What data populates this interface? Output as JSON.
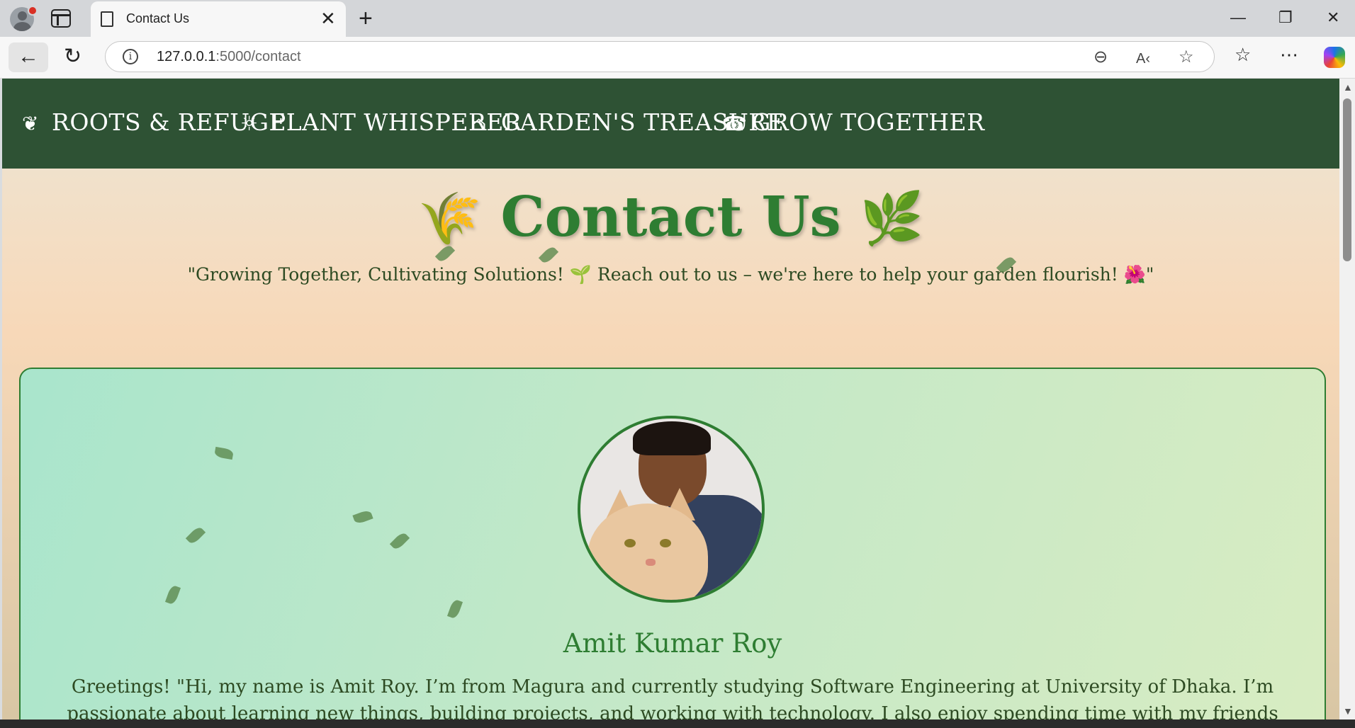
{
  "browser": {
    "tab_title": "Contact Us",
    "url_host": "127.0.0.1",
    "url_path": ":5000/contact"
  },
  "nav": {
    "items": [
      {
        "label": "ROOTS & REFUGE",
        "icon": "leaf-icon"
      },
      {
        "label": "PLANT WHISPERER",
        "icon": "lightbulb-icon"
      },
      {
        "label": "GARDEN'S TREASURE",
        "icon": "shopping-bag-icon"
      },
      {
        "label": "GROW TOGETHER",
        "icon": "phone-icon"
      }
    ]
  },
  "hero": {
    "title": "Contact Us",
    "subtitle_part1": "\"Growing Together, Cultivating Solutions! ",
    "subtitle_part2": " Reach out to us – we're here to help your garden flourish! ",
    "subtitle_end": "\""
  },
  "profile": {
    "name": "Amit Kumar Roy",
    "bio": "Greetings! \"Hi, my name is Amit Roy. I’m from Magura and currently studying Software Engineering at University of Dhaka. I’m passionate about learning new things, building projects, and working with technology. I also enjoy spending time with my friends and family. In the"
  },
  "colors": {
    "nav_bg": "#2e5234",
    "accent": "#2e7d32",
    "card_bg": "#a9e5cc"
  }
}
